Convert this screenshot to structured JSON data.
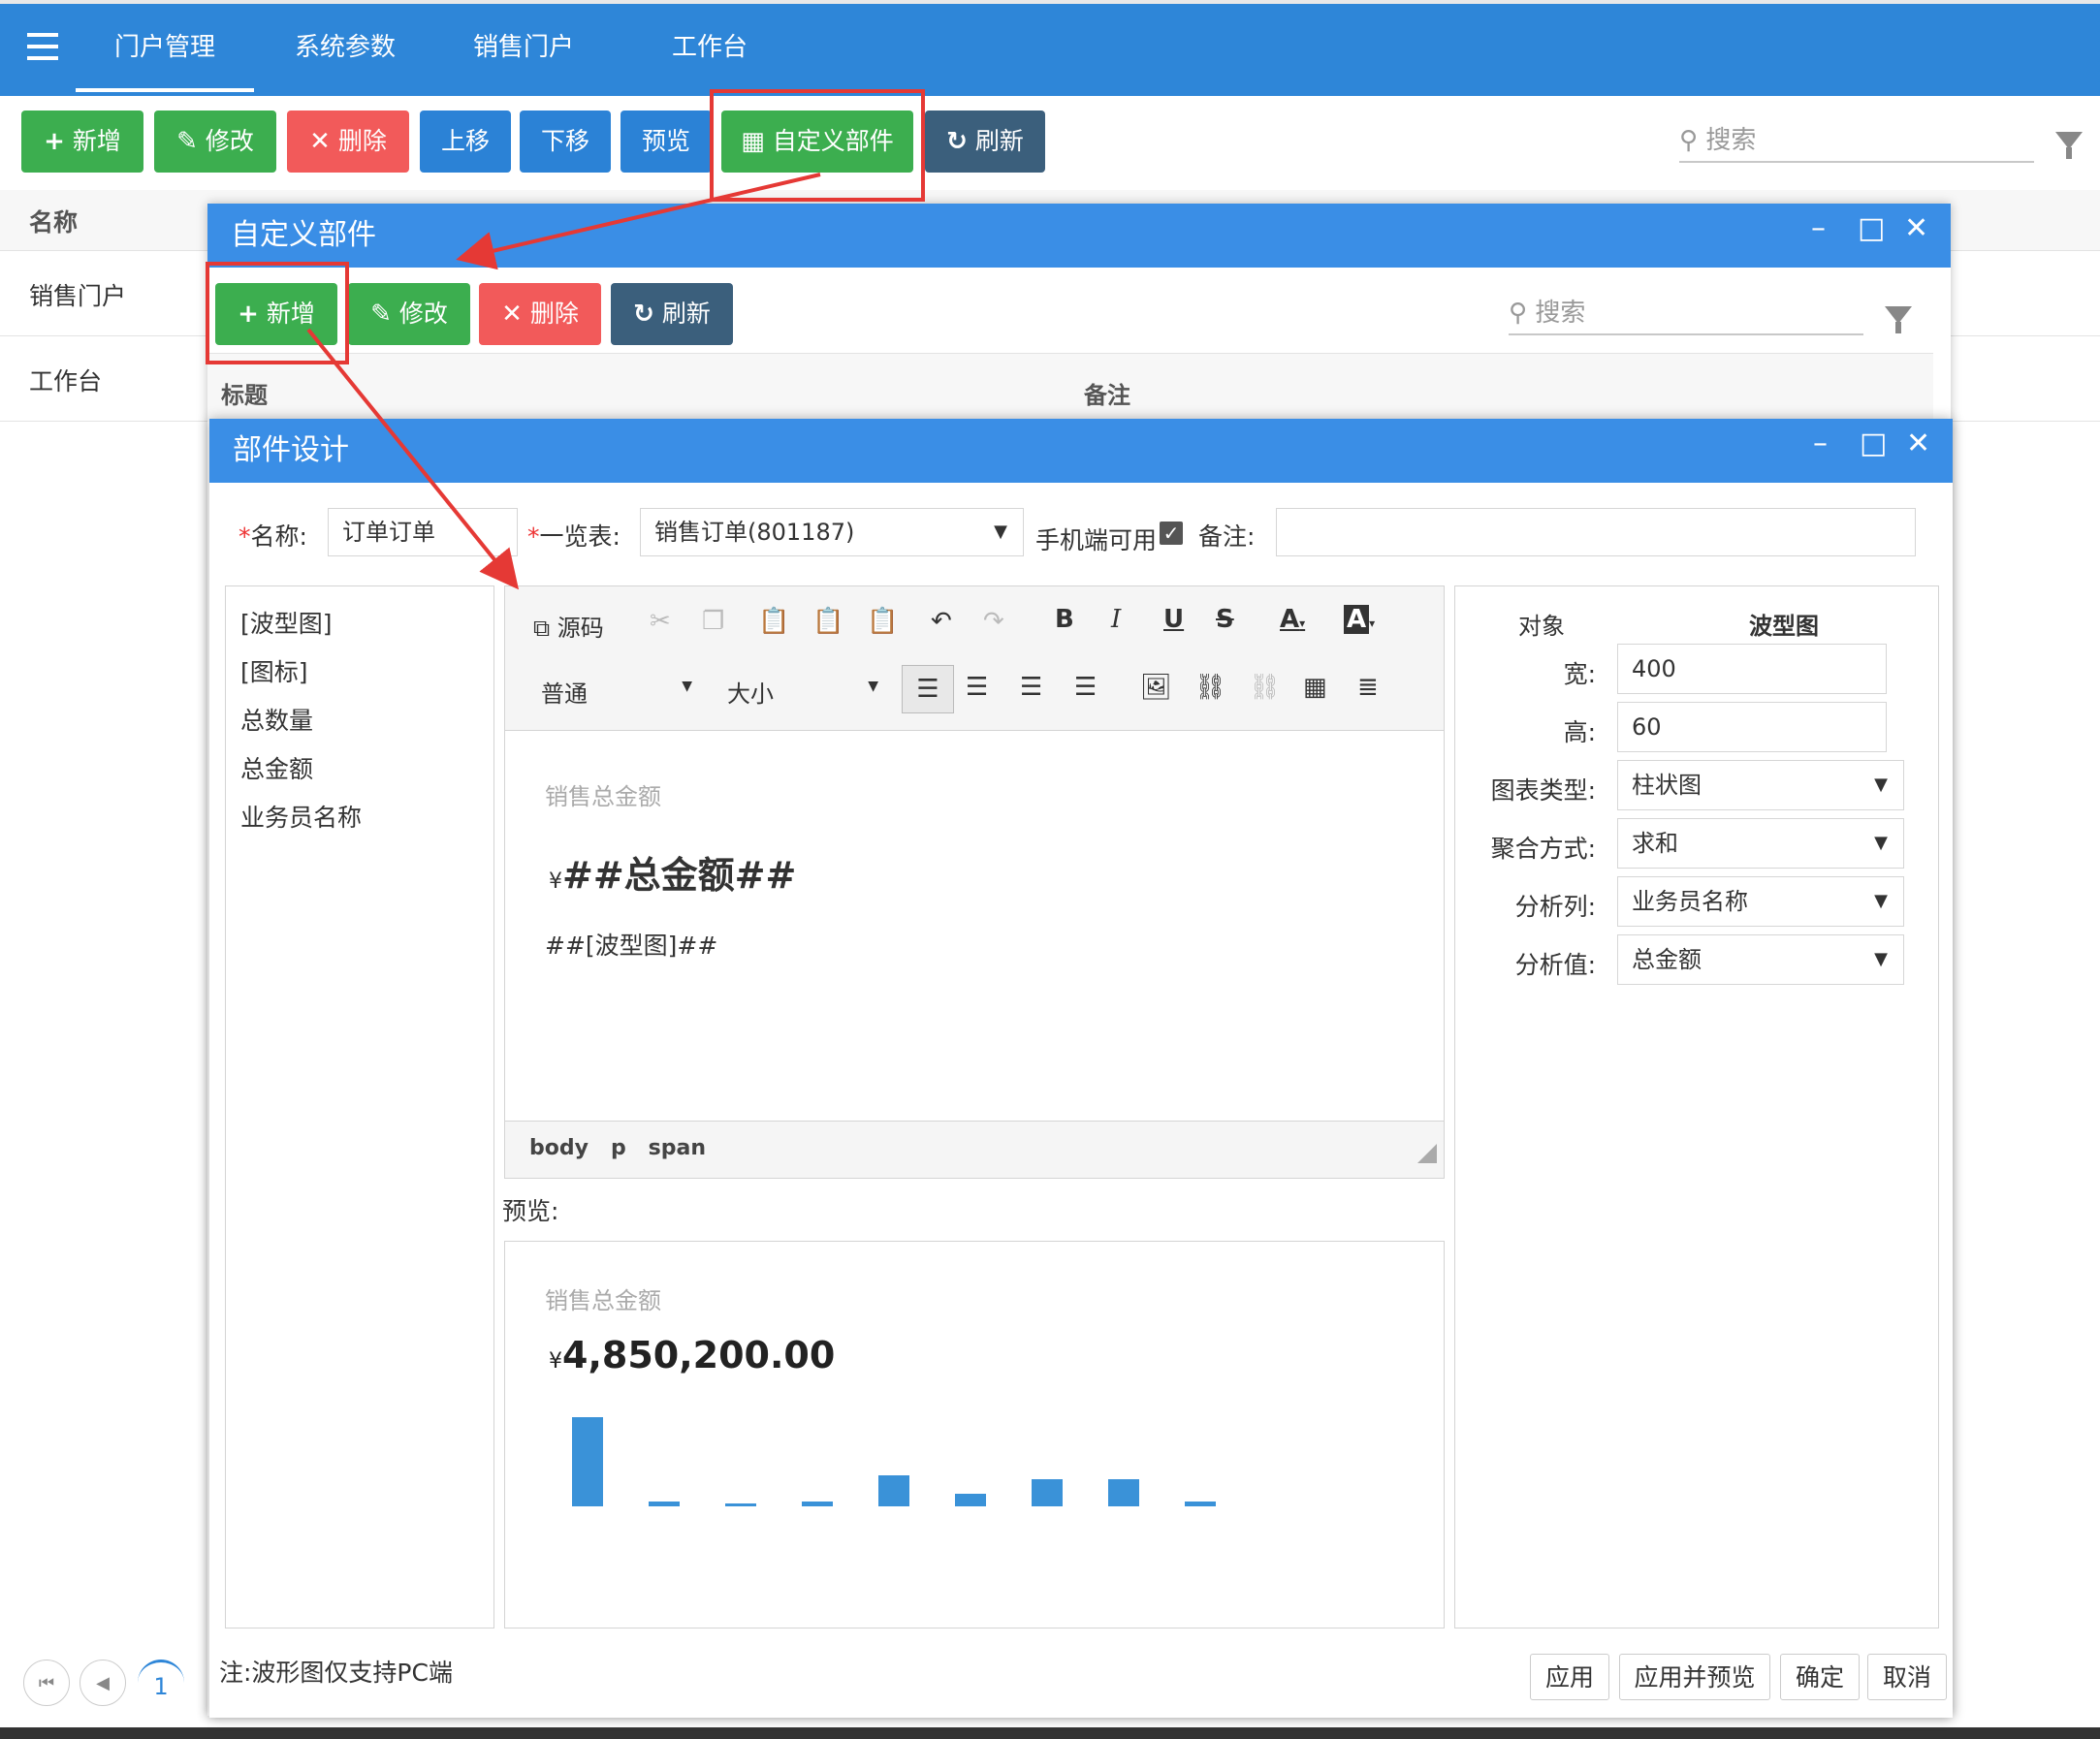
{
  "topnav": {
    "tabs": [
      "门户管理",
      "系统参数",
      "销售门户",
      "工作台"
    ]
  },
  "main_toolbar": {
    "add": "新增",
    "edit": "修改",
    "delete": "删除",
    "up": "上移",
    "down": "下移",
    "preview": "预览",
    "custom_part": "自定义部件",
    "refresh": "刷新",
    "search_placeholder": "搜索"
  },
  "main_list": {
    "header": "名称",
    "rows": [
      "销售门户",
      "工作台"
    ]
  },
  "pager": {
    "page": "1"
  },
  "custom_dialog": {
    "title": "自定义部件",
    "toolbar": {
      "add": "新增",
      "edit": "修改",
      "delete": "删除",
      "refresh": "刷新",
      "search_placeholder": "搜索"
    },
    "columns": [
      "标题",
      "备注"
    ]
  },
  "design_dialog": {
    "title": "部件设计",
    "form": {
      "name_label": "名称:",
      "name_value": "订单订单",
      "list_label": "一览表:",
      "list_value": "销售订单(801187)",
      "mobile_label": "手机端可用",
      "mobile_checked": true,
      "remark_label": "备注:",
      "remark_value": ""
    },
    "field_list": [
      "[波型图]",
      "[图标]",
      "总数量",
      "总金额",
      "业务员名称"
    ],
    "editor": {
      "toolbar": {
        "source": "源码",
        "format": "普通",
        "size": "大小",
        "bold": "B",
        "italic": "I",
        "underline": "U",
        "strike": "S",
        "font_color": "A",
        "bg_color": "A"
      },
      "content": {
        "caption": "销售总金额",
        "currency": "¥",
        "amount_tpl": "##总金额##",
        "chart_tpl": "##[波型图]##"
      },
      "path": [
        "body",
        "p",
        "span"
      ]
    },
    "preview": {
      "label": "预览:",
      "caption": "销售总金额",
      "currency": "¥",
      "amount": "4,850,200.00",
      "chart_data": {
        "type": "bar",
        "values": [
          100,
          5,
          2,
          5,
          35,
          14,
          30,
          30,
          5
        ],
        "ylim": [
          0,
          100
        ]
      }
    },
    "properties": {
      "header_object": "对象",
      "header_value": "波型图",
      "width_label": "宽:",
      "width_value": "400",
      "height_label": "高:",
      "height_value": "60",
      "chart_type_label": "图表类型:",
      "chart_type_value": "柱状图",
      "agg_label": "聚合方式:",
      "agg_value": "求和",
      "col_label": "分析列:",
      "col_value": "业务员名称",
      "val_label": "分析值:",
      "val_value": "总金额"
    },
    "note": "注:波形图仅支持PC端",
    "footer": {
      "apply": "应用",
      "apply_preview": "应用并预览",
      "ok": "确定",
      "cancel": "取消"
    }
  },
  "colors": {
    "nav": "#2e86d8",
    "dialog_title": "#3a8ee6",
    "green": "#3cae4f",
    "red": "#f25a5a",
    "highlight": "#e53935",
    "bar": "#3a92d8"
  }
}
